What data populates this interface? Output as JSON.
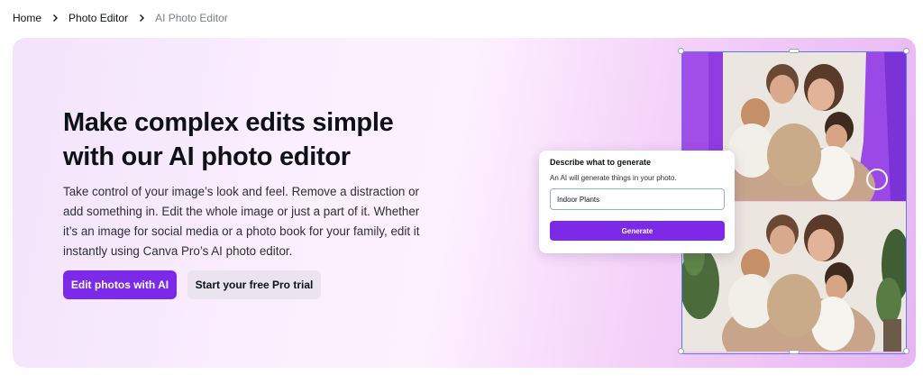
{
  "breadcrumb": {
    "items": [
      "Home",
      "Photo Editor"
    ],
    "current": "AI Photo Editor"
  },
  "hero": {
    "title_line1": "Make complex edits simple",
    "title_line2": "with our AI photo editor",
    "description": "Take control of your image’s look and feel. Remove a distraction or add something in. Edit the whole image or just a part of it. Whether it’s an image for social media or a photo book for your family, edit it instantly using Canva Pro’s AI photo editor.",
    "primary_button": "Edit photos with AI",
    "secondary_button": "Start your free Pro trial"
  },
  "generate_panel": {
    "title": "Describe what to generate",
    "hint": "An AI will generate things in your photo.",
    "input_value": "Indoor Plants",
    "button": "Generate"
  },
  "colors": {
    "accent": "#7d2ae8",
    "secondary_button_bg": "#ece3f1",
    "text": "#0d1216"
  },
  "icons": {
    "breadcrumb_separator": "chevron-right-icon"
  }
}
